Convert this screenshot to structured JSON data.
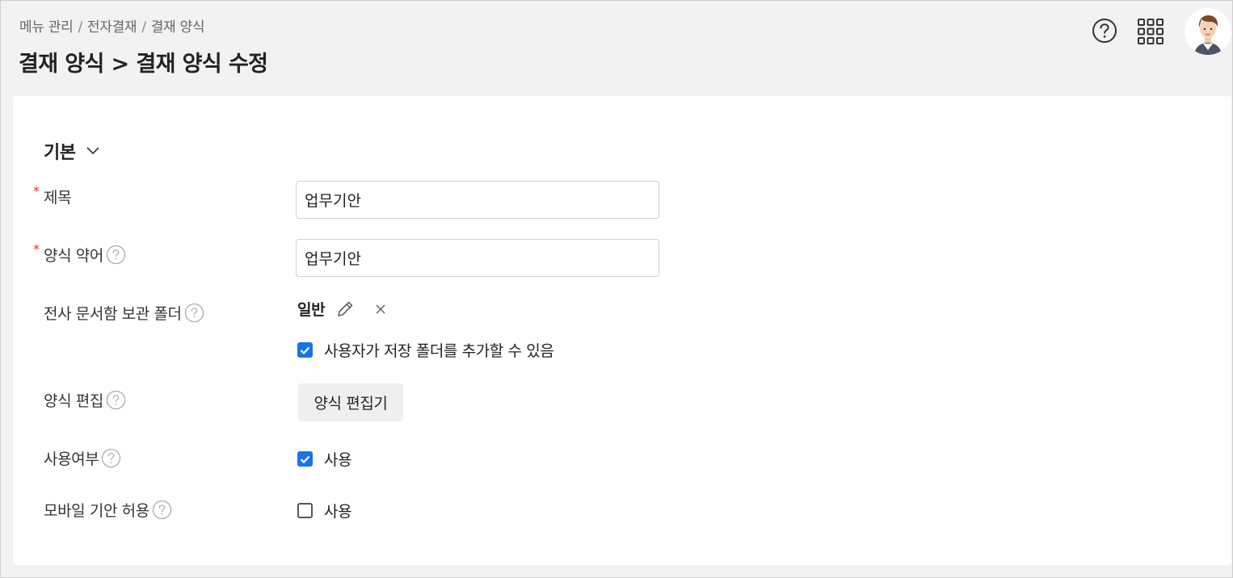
{
  "breadcrumb": [
    "메뉴 관리",
    "전자결재",
    "결재 양식"
  ],
  "page_title": "결재 양식 > 결재 양식 수정",
  "header_icons": [
    "help-icon",
    "apps-grid-icon",
    "user-avatar"
  ],
  "section": {
    "title": "기본",
    "expanded": true
  },
  "fields": {
    "title": {
      "label": "제목",
      "required": true,
      "value": "업무기안"
    },
    "abbreviation": {
      "label": "양식 약어",
      "required": true,
      "value": "업무기안"
    },
    "folder": {
      "label": "전사 문서함 보관 폴더",
      "value": "일반",
      "allow_user_folder_label": "사용자가 저장 폴더를 추가할 수 있음",
      "allow_user_folder_checked": true
    },
    "form_edit": {
      "label": "양식 편집",
      "button_label": "양식 편집기"
    },
    "in_use": {
      "label": "사용여부",
      "option_label": "사용",
      "checked": true
    },
    "mobile_draft": {
      "label": "모바일 기안 허용",
      "option_label": "사용",
      "checked": false
    }
  },
  "colors": {
    "accent": "#1a73e8",
    "required": "#e03232",
    "background": "#f2f2f2"
  }
}
